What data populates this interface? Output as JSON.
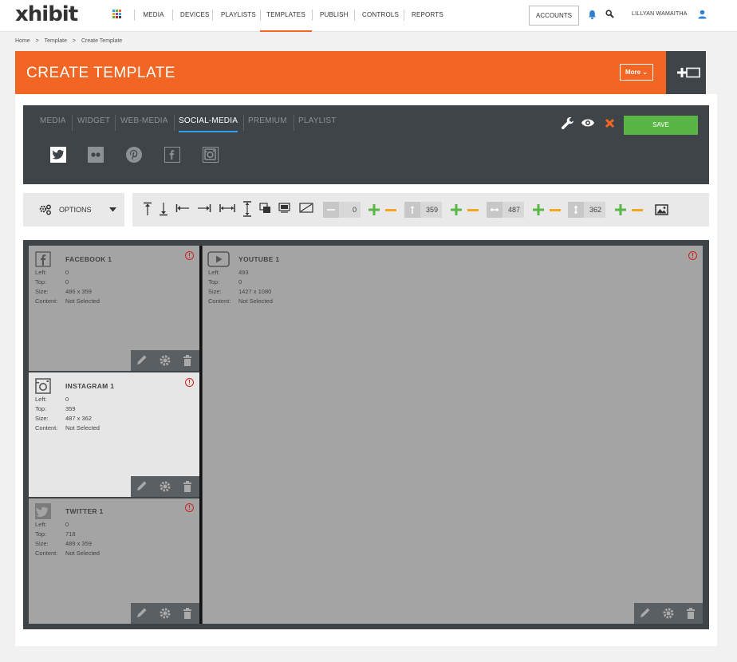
{
  "app": {
    "logo": "xhibit",
    "nav": [
      "MEDIA",
      "DEVICES",
      "PLAYLISTS",
      "TEMPLATES",
      "PUBLISH",
      "CONTROLS",
      "REPORTS"
    ],
    "active_nav": "TEMPLATES",
    "accounts_label": "ACCOUNTS",
    "user_name": "LILLYAN WAMAITHA"
  },
  "breadcrumb": [
    "Home",
    ">",
    "Template",
    ">",
    "Create Template"
  ],
  "page": {
    "title": "CREATE TEMPLATE",
    "more_label": "More ⌄"
  },
  "toolbar": {
    "tabs": [
      "MEDIA",
      "WIDGET",
      "WEB-MEDIA",
      "SOCIAL-MEDIA",
      "PREMIUM",
      "PLAYLIST"
    ],
    "active_tab": "SOCIAL-MEDIA",
    "save_label": "SAVE",
    "social_icons": [
      "twitter-icon",
      "flickr-icon",
      "pinterest-icon",
      "facebook-icon",
      "instagram-icon"
    ]
  },
  "options": {
    "label": "OPTIONS",
    "left_value": "0",
    "top_value": "359",
    "width_value": "487",
    "height_value": "362"
  },
  "colors": {
    "brand": "#f26522",
    "save": "#59b646",
    "dark": "#3f4449",
    "accent_tab": "#2ea3f2",
    "plus": "#59b646",
    "minus": "#f5a623"
  },
  "blocks": {
    "facebook": {
      "title": "FACEBOOK 1",
      "left_label": "Left:",
      "left": "0",
      "top_label": "Top:",
      "top": "0",
      "size_label": "Size:",
      "size": "486 x 359",
      "content_label": "Content:",
      "content": "Not Selected"
    },
    "youtube": {
      "title": "YOUTUBE 1",
      "left_label": "Left:",
      "left": "493",
      "top_label": "Top:",
      "top": "0",
      "size_label": "Size:",
      "size": "1427 x 1080",
      "content_label": "Content:",
      "content": "Not Selected"
    },
    "instagram": {
      "title": "INSTAGRAM 1",
      "left_label": "Left:",
      "left": "0",
      "top_label": "Top:",
      "top": "359",
      "size_label": "Size:",
      "size": "487 x 362",
      "content_label": "Content:",
      "content": "Not Selected"
    },
    "twitter": {
      "title": "TWITTER 1",
      "left_label": "Left:",
      "left": "0",
      "top_label": "Top:",
      "top": "718",
      "size_label": "Size:",
      "size": "489 x 359",
      "content_label": "Content:",
      "content": "Not Selected"
    }
  }
}
